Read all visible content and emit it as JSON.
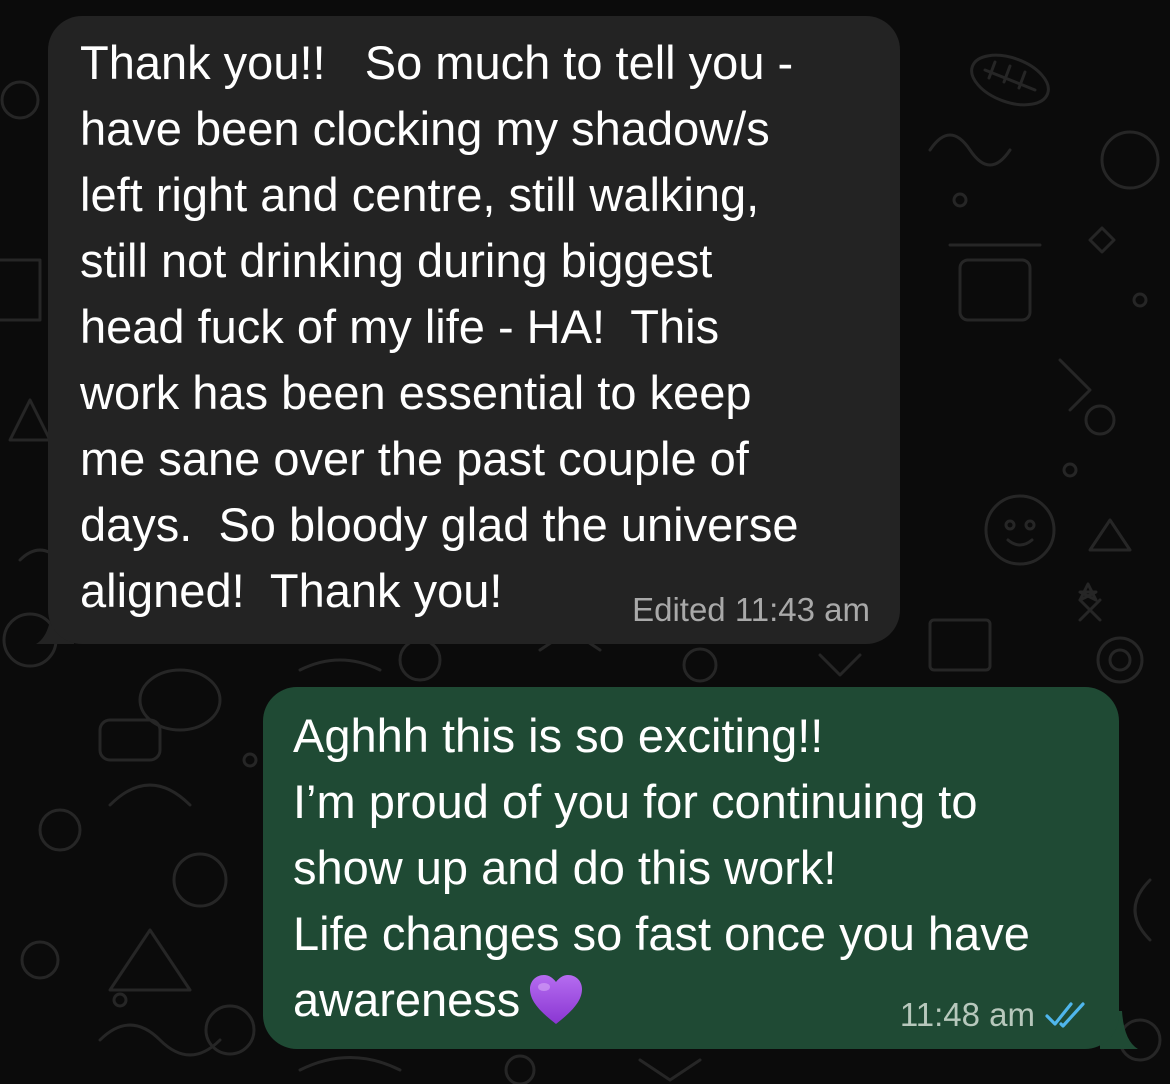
{
  "messages": {
    "incoming": {
      "lines": [
        "Thank you!!   So much to tell you -",
        "have been clocking my shadow/s",
        "left right and centre, still walking,",
        "still not drinking during biggest",
        "head fuck of my life - HA!  This",
        "work has been essential to keep",
        "me sane over the past couple of",
        "days.  So bloody glad the universe",
        "aligned!  Thank you!"
      ],
      "edited_label": "Edited",
      "time": "11:43 am"
    },
    "outgoing": {
      "lines": [
        "Aghhh this is so exciting!!",
        "I’m proud of you for continuing to",
        "show up and do this work!",
        "Life changes so fast once you have",
        "awareness"
      ],
      "emoji": "purple-heart-icon",
      "time": "11:48 am",
      "status": "read-double-tick-icon"
    }
  },
  "colors": {
    "background": "#0b0b0b",
    "incoming_bubble": "#232323",
    "outgoing_bubble": "#1f4a34",
    "read_tick": "#4fb6ec",
    "heart": "#9b4bd9"
  }
}
